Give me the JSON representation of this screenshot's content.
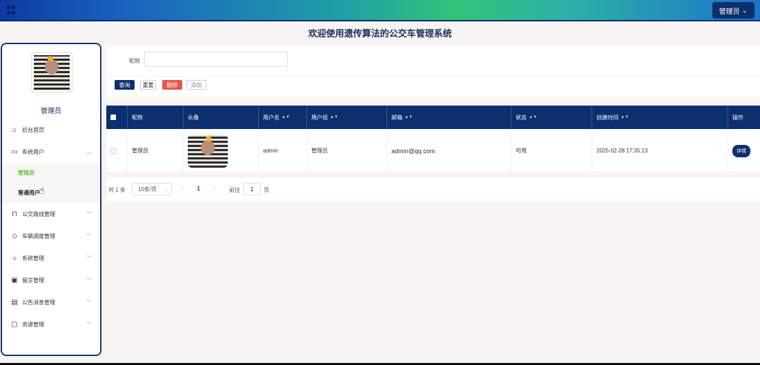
{
  "topbar": {
    "admin_label": "管理员"
  },
  "page_title": "欢迎使用遗传算法的公交车管理系统",
  "sidebar": {
    "user_name": "管理员",
    "items": [
      {
        "label": "后台首页",
        "icon": "home-icon"
      },
      {
        "label": "系统用户",
        "icon": "monitor-icon",
        "expanded": true,
        "children": [
          {
            "label": "管理员",
            "active": true
          },
          {
            "label": "普通用户"
          }
        ]
      },
      {
        "label": "公交路线管理",
        "icon": "bookmark-icon"
      },
      {
        "label": "车辆调度管理",
        "icon": "tag-icon"
      },
      {
        "label": "系统管理",
        "icon": "sun-icon"
      },
      {
        "label": "留言管理",
        "icon": "inbox-icon"
      },
      {
        "label": "公告消息管理",
        "icon": "clipboard-icon"
      },
      {
        "label": "资源管理",
        "icon": "message-icon"
      }
    ]
  },
  "search": {
    "label": "昵称",
    "value": "",
    "placeholder": ""
  },
  "actions": {
    "query": "查询",
    "reset": "重置",
    "delete": "删除",
    "add": "添加"
  },
  "table": {
    "headers": [
      "昵称",
      "头像",
      "用户名",
      "用户组",
      "邮箱",
      "状态",
      "创建时间",
      "操作"
    ],
    "rows": [
      {
        "nickname": "管理员",
        "username": "admin",
        "group": "管理员",
        "email": "admin@qq.com",
        "status": "可用",
        "created": "2025-02-28 17:35:13",
        "action": "详情"
      }
    ]
  },
  "pagination": {
    "total": "共 1 条",
    "page_size": "10条/页",
    "current": "1",
    "goto_label": "前往",
    "goto_value": "1",
    "page_suffix": "页"
  },
  "colors": {
    "primary": "#0c2f6e",
    "danger": "#e1594f",
    "active_menu": "#6fbe3b"
  }
}
